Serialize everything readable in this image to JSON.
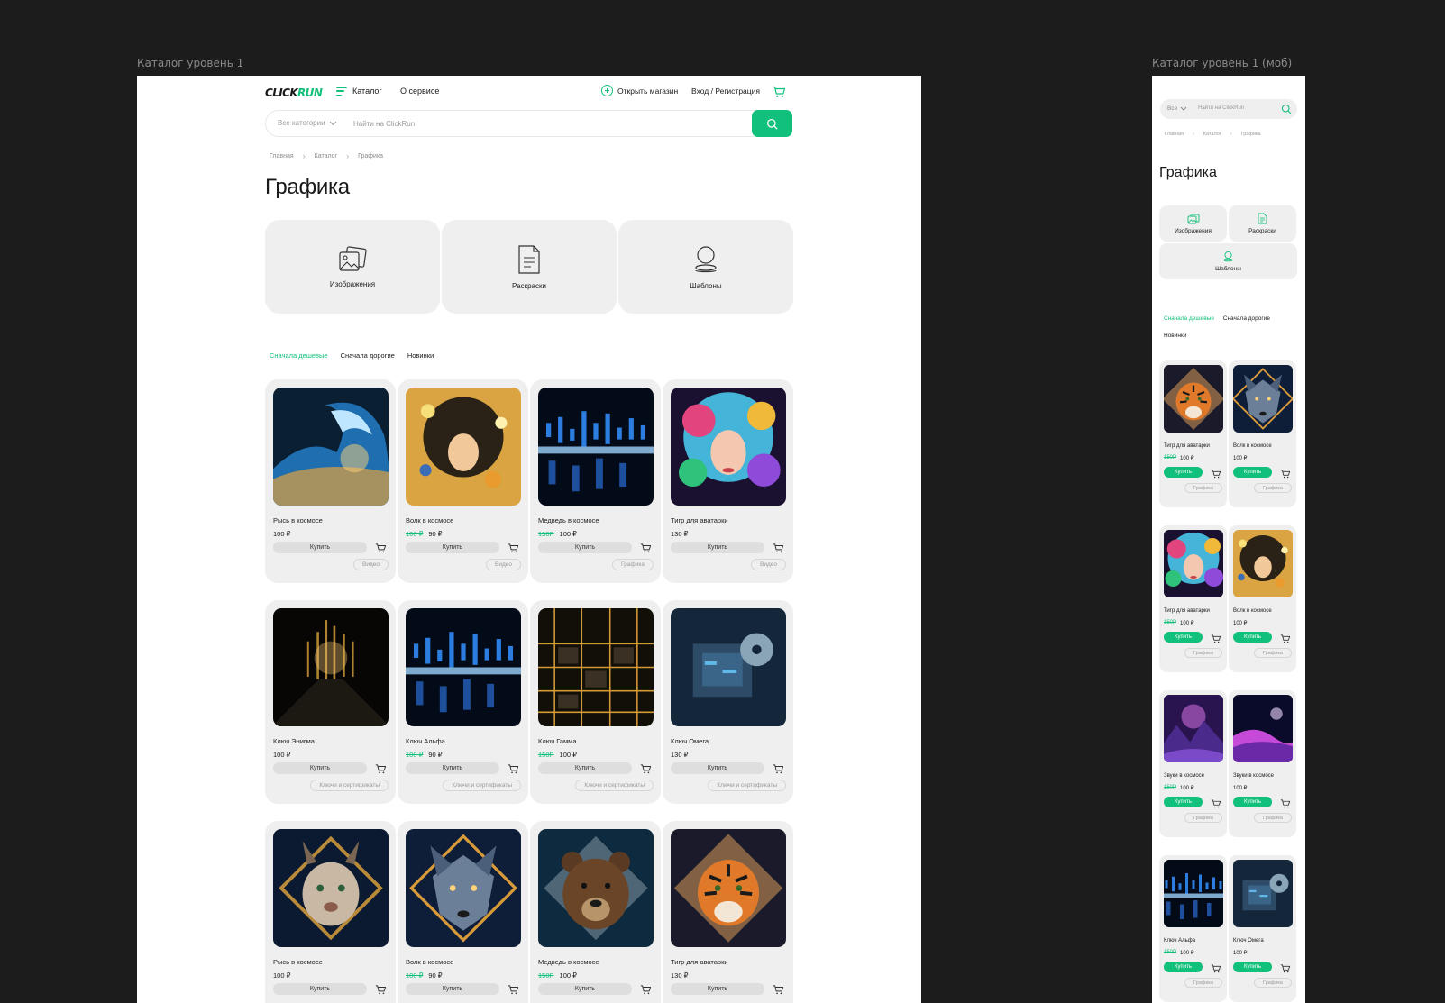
{
  "frames": {
    "desktop_label": "Каталог уровень 1",
    "mobile_label": "Каталог уровень 1 (моб)"
  },
  "brand": {
    "logo_part1": "CLICK",
    "logo_part2": "RUN",
    "accent": "#11c07a"
  },
  "header": {
    "catalog": "Каталог",
    "about": "О сервисе",
    "open_shop": "Открыть магазин",
    "login": "Вход / Регистрация"
  },
  "search": {
    "category": "Все категории",
    "placeholder": "Найти на ClickRun",
    "mobile_category": "Все"
  },
  "breadcrumbs": [
    "Главная",
    "Каталог",
    "Графика"
  ],
  "page_title": "Графика",
  "categories": [
    {
      "label": "Изображения",
      "icon": "images-icon"
    },
    {
      "label": "Раскраски",
      "icon": "coloring-icon"
    },
    {
      "label": "Шаблоны",
      "icon": "templates-icon"
    }
  ],
  "sort": [
    "Сначала дешевые",
    "Сначала дорогие",
    "Новинки"
  ],
  "buy_label": "Купить",
  "products": [
    {
      "name": "Рысь в космосе",
      "old": "",
      "price": "100 ₽",
      "tag": "Видео",
      "art": "wave"
    },
    {
      "name": "Волк в космосе",
      "old": "100 ₽",
      "price": "90 ₽",
      "tag": "Видео",
      "art": "butterfly"
    },
    {
      "name": "Медведь в космосе",
      "old": "150Р",
      "price": "100 ₽",
      "tag": "Графика",
      "art": "digital"
    },
    {
      "name": "Тигр для аватарки",
      "old": "",
      "price": "130 ₽",
      "tag": "Видео",
      "art": "colorgirl"
    },
    {
      "name": "Ключ Энигма",
      "old": "",
      "price": "100 ₽",
      "tag": "Ключи и сертификаты",
      "art": "tunnel"
    },
    {
      "name": "Ключ Альфа",
      "old": "100 ₽",
      "price": "90 ₽",
      "tag": "Ключи и сертификаты",
      "art": "digital"
    },
    {
      "name": "Ключ Гамма",
      "old": "150Р",
      "price": "100 ₽",
      "tag": "Ключи и сертификаты",
      "art": "city"
    },
    {
      "name": "Ключ Омега",
      "old": "",
      "price": "130 ₽",
      "tag": "Ключи и сертификаты",
      "art": "chip"
    },
    {
      "name": "Рысь в космосе",
      "old": "",
      "price": "100 ₽",
      "tag": "",
      "art": "lynx"
    },
    {
      "name": "Волк в космосе",
      "old": "100 ₽",
      "price": "90 ₽",
      "tag": "",
      "art": "wolf"
    },
    {
      "name": "Медведь в космосе",
      "old": "150Р",
      "price": "100 ₽",
      "tag": "",
      "art": "bear"
    },
    {
      "name": "Тигр для аватарки",
      "old": "",
      "price": "130 ₽",
      "tag": "",
      "art": "tiger"
    }
  ],
  "mobile_products": [
    {
      "name": "Тигр для аватарки",
      "old": "150Р",
      "price": "100 ₽",
      "tag": "Графика",
      "art": "tiger"
    },
    {
      "name": "Волк в космосе",
      "old": "",
      "price": "100 ₽",
      "tag": "Графика",
      "art": "wolf"
    },
    {
      "name": "Тигр для аватарки",
      "old": "150Р",
      "price": "100 ₽",
      "tag": "Графика",
      "art": "colorgirl"
    },
    {
      "name": "Волк в космосе",
      "old": "",
      "price": "100 ₽",
      "tag": "Графика",
      "art": "butterfly"
    },
    {
      "name": "Звуки в космосе",
      "old": "150Р",
      "price": "100 ₽",
      "tag": "Графика",
      "art": "mountain"
    },
    {
      "name": "Звуки в космосе",
      "old": "",
      "price": "100 ₽",
      "tag": "Графика",
      "art": "dunes"
    },
    {
      "name": "Ключ Альфа",
      "old": "150Р",
      "price": "100 ₽",
      "tag": "Графика",
      "art": "digital"
    },
    {
      "name": "Ключ Омега",
      "old": "",
      "price": "100 ₽",
      "tag": "Графика",
      "art": "chip"
    }
  ]
}
